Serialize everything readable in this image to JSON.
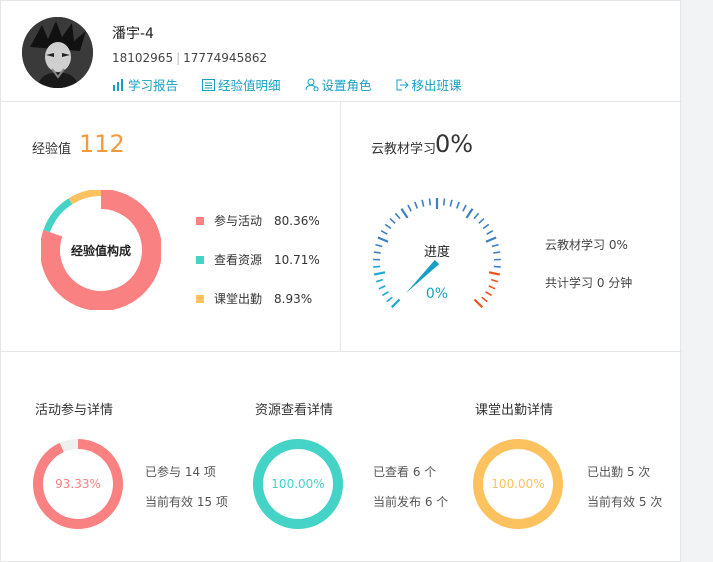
{
  "user": {
    "name": "潘宇-4",
    "id": "18102965",
    "phone": "17774945862"
  },
  "links": [
    {
      "label": "学习报告",
      "icon": "bar-chart-icon"
    },
    {
      "label": "经验值明细",
      "icon": "list-icon"
    },
    {
      "label": "设置角色",
      "icon": "user-settings-icon"
    },
    {
      "label": "移出班课",
      "icon": "exit-icon"
    }
  ],
  "experience": {
    "title": "经验值",
    "value": "112",
    "donut_center": "经验值构成",
    "legend": [
      {
        "label": "参与活动",
        "percent": "80.36%",
        "color": "#fa8181"
      },
      {
        "label": "查看资源",
        "percent": "10.71%",
        "color": "#45d3c7"
      },
      {
        "label": "课堂出勤",
        "percent": "8.93%",
        "color": "#fbc25f"
      }
    ]
  },
  "cloud": {
    "title": "云教材学习",
    "value": "0%",
    "gauge_label": "进度",
    "gauge_value": "0%",
    "progress": 0,
    "study_label": "云教材学习 0%",
    "total_label": "共计学习 0 分钟"
  },
  "details": [
    {
      "title": "活动参与详情",
      "percent_text": "93.33%",
      "fraction": 0.9333,
      "color": "#fa8181",
      "track": "#efefef",
      "line1": "已参与 14 项",
      "line2": "当前有效 15 项"
    },
    {
      "title": "资源查看详情",
      "percent_text": "100.00%",
      "fraction": 1.0,
      "color": "#45d3c7",
      "track": "#efefef",
      "line1": "已查看 6 个",
      "line2": "当前发布 6 个"
    },
    {
      "title": "课堂出勤详情",
      "percent_text": "100.00%",
      "fraction": 1.0,
      "color": "#fbc25f",
      "track": "#efefef",
      "line1": "已出勤 5 次",
      "line2": "当前有效 5 次"
    }
  ]
}
